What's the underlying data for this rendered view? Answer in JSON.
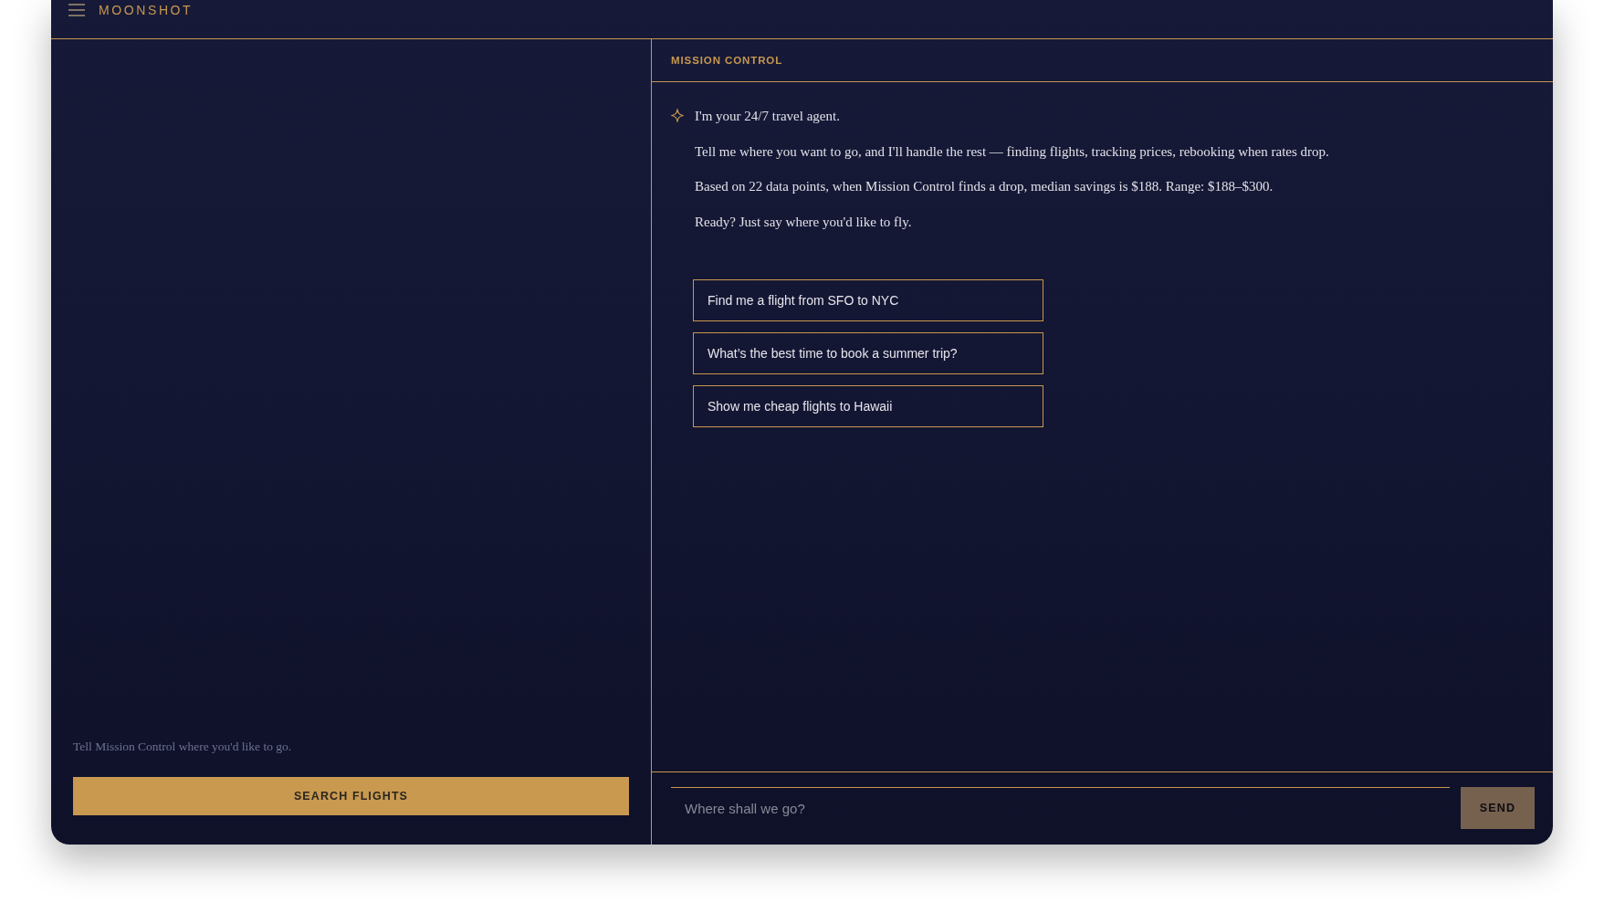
{
  "header": {
    "brand": "MOONSHOT"
  },
  "sidebar": {
    "hint": "Tell Mission Control where you'd like to go.",
    "search_button": "SEARCH FLIGHTS"
  },
  "chat": {
    "title": "MISSION CONTROL",
    "message": {
      "paragraphs": [
        "I'm your 24/7 travel agent.",
        "Tell me where you want to go, and I'll handle the rest — finding flights, tracking prices, rebooking when rates drop.",
        "Based on 22 data points, when Mission Control finds a drop, median savings is $188. Range: $188–$300.",
        "Ready? Just say where you'd like to fly."
      ]
    },
    "suggestions": [
      "Find me a flight from SFO to NYC",
      "What’s the best time to book a summer trip?",
      "Show me cheap flights to Hawaii"
    ],
    "input": {
      "placeholder": "Where shall we go?"
    },
    "send_button": {
      "label": "SEND",
      "disabled": true
    }
  }
}
